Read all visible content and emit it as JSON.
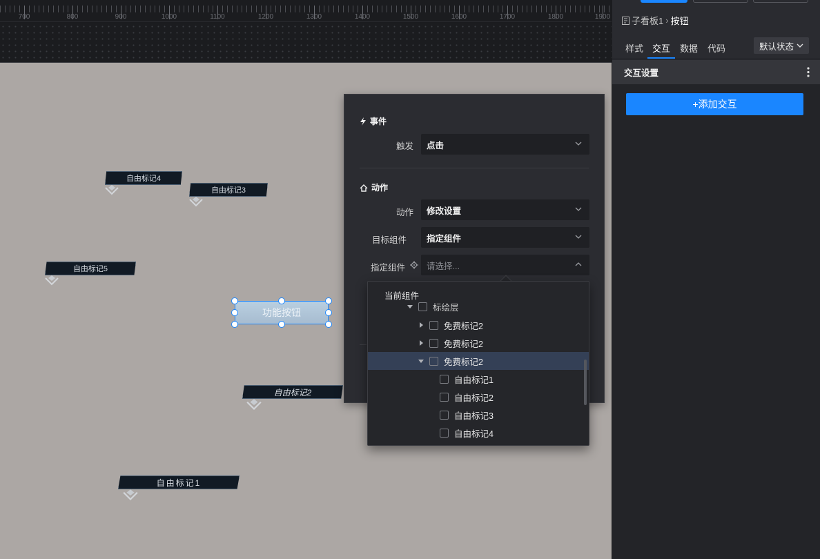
{
  "ruler": {
    "labels": [
      "700",
      "800",
      "900",
      "1000",
      "1100",
      "1200",
      "1300",
      "1400",
      "1500",
      "1600",
      "1700",
      "1800",
      "1900"
    ]
  },
  "canvas": {
    "markers": [
      {
        "id": "m4",
        "label": "自由标记4"
      },
      {
        "id": "m3",
        "label": "自由标记3"
      },
      {
        "id": "m5",
        "label": "自由标记5"
      },
      {
        "id": "m2",
        "label": "自由标记2"
      },
      {
        "id": "m1",
        "label": "自由标记1"
      }
    ],
    "function_button": "功能按钮"
  },
  "interaction_panel": {
    "event_title": "事件",
    "trigger_label": "触发",
    "trigger_value": "点击",
    "action_title": "动作",
    "action_label": "动作",
    "action_value": "修改设置",
    "target_label": "目标组件",
    "target_value": "指定组件",
    "specified_label": "指定组件",
    "specified_placeholder": "请选择..."
  },
  "tree": {
    "root_label": "当前组件",
    "layer_label": "标绘层",
    "items": [
      {
        "label": "免费标记2",
        "expanded": false
      },
      {
        "label": "免费标记2",
        "expanded": false
      },
      {
        "label": "免费标记2",
        "expanded": true,
        "highlighted": true
      }
    ],
    "children": [
      "自由标记1",
      "自由标记2",
      "自由标记3",
      "自由标记4"
    ]
  },
  "right_panel": {
    "breadcrumb_parent": "子看板1",
    "breadcrumb_separator": "›",
    "breadcrumb_current": "按钮",
    "tabs": [
      "样式",
      "交互",
      "数据",
      "代码"
    ],
    "active_tab": "交互",
    "state_select": "默认状态",
    "section_title": "交互设置",
    "add_button": "+添加交互"
  },
  "colors": {
    "accent": "#1a86ff",
    "canvas_bg": "#aca7a4",
    "panel_bg": "#2b2c31",
    "highlight_row": "#344056"
  }
}
